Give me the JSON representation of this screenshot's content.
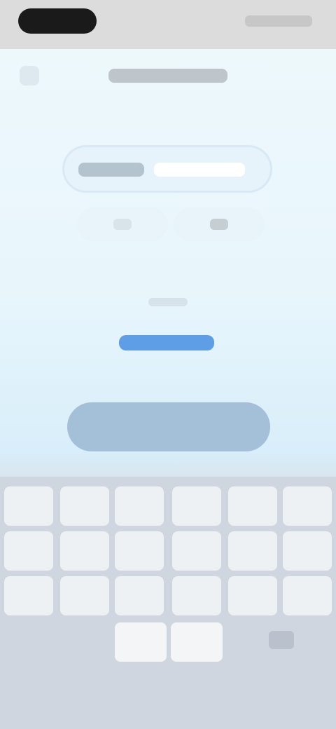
{
  "app": {
    "title": "",
    "country_code": "",
    "phone_placeholder": "",
    "hint": "",
    "link_label": "",
    "primary_button_label": ""
  },
  "colors": {
    "accent": "#5d9ee6",
    "button_disabled": "#a4bfd8",
    "keyboard_bg": "#cfd6df"
  },
  "icons": {
    "back": "chevron-left-icon",
    "delete": "backspace-icon"
  }
}
